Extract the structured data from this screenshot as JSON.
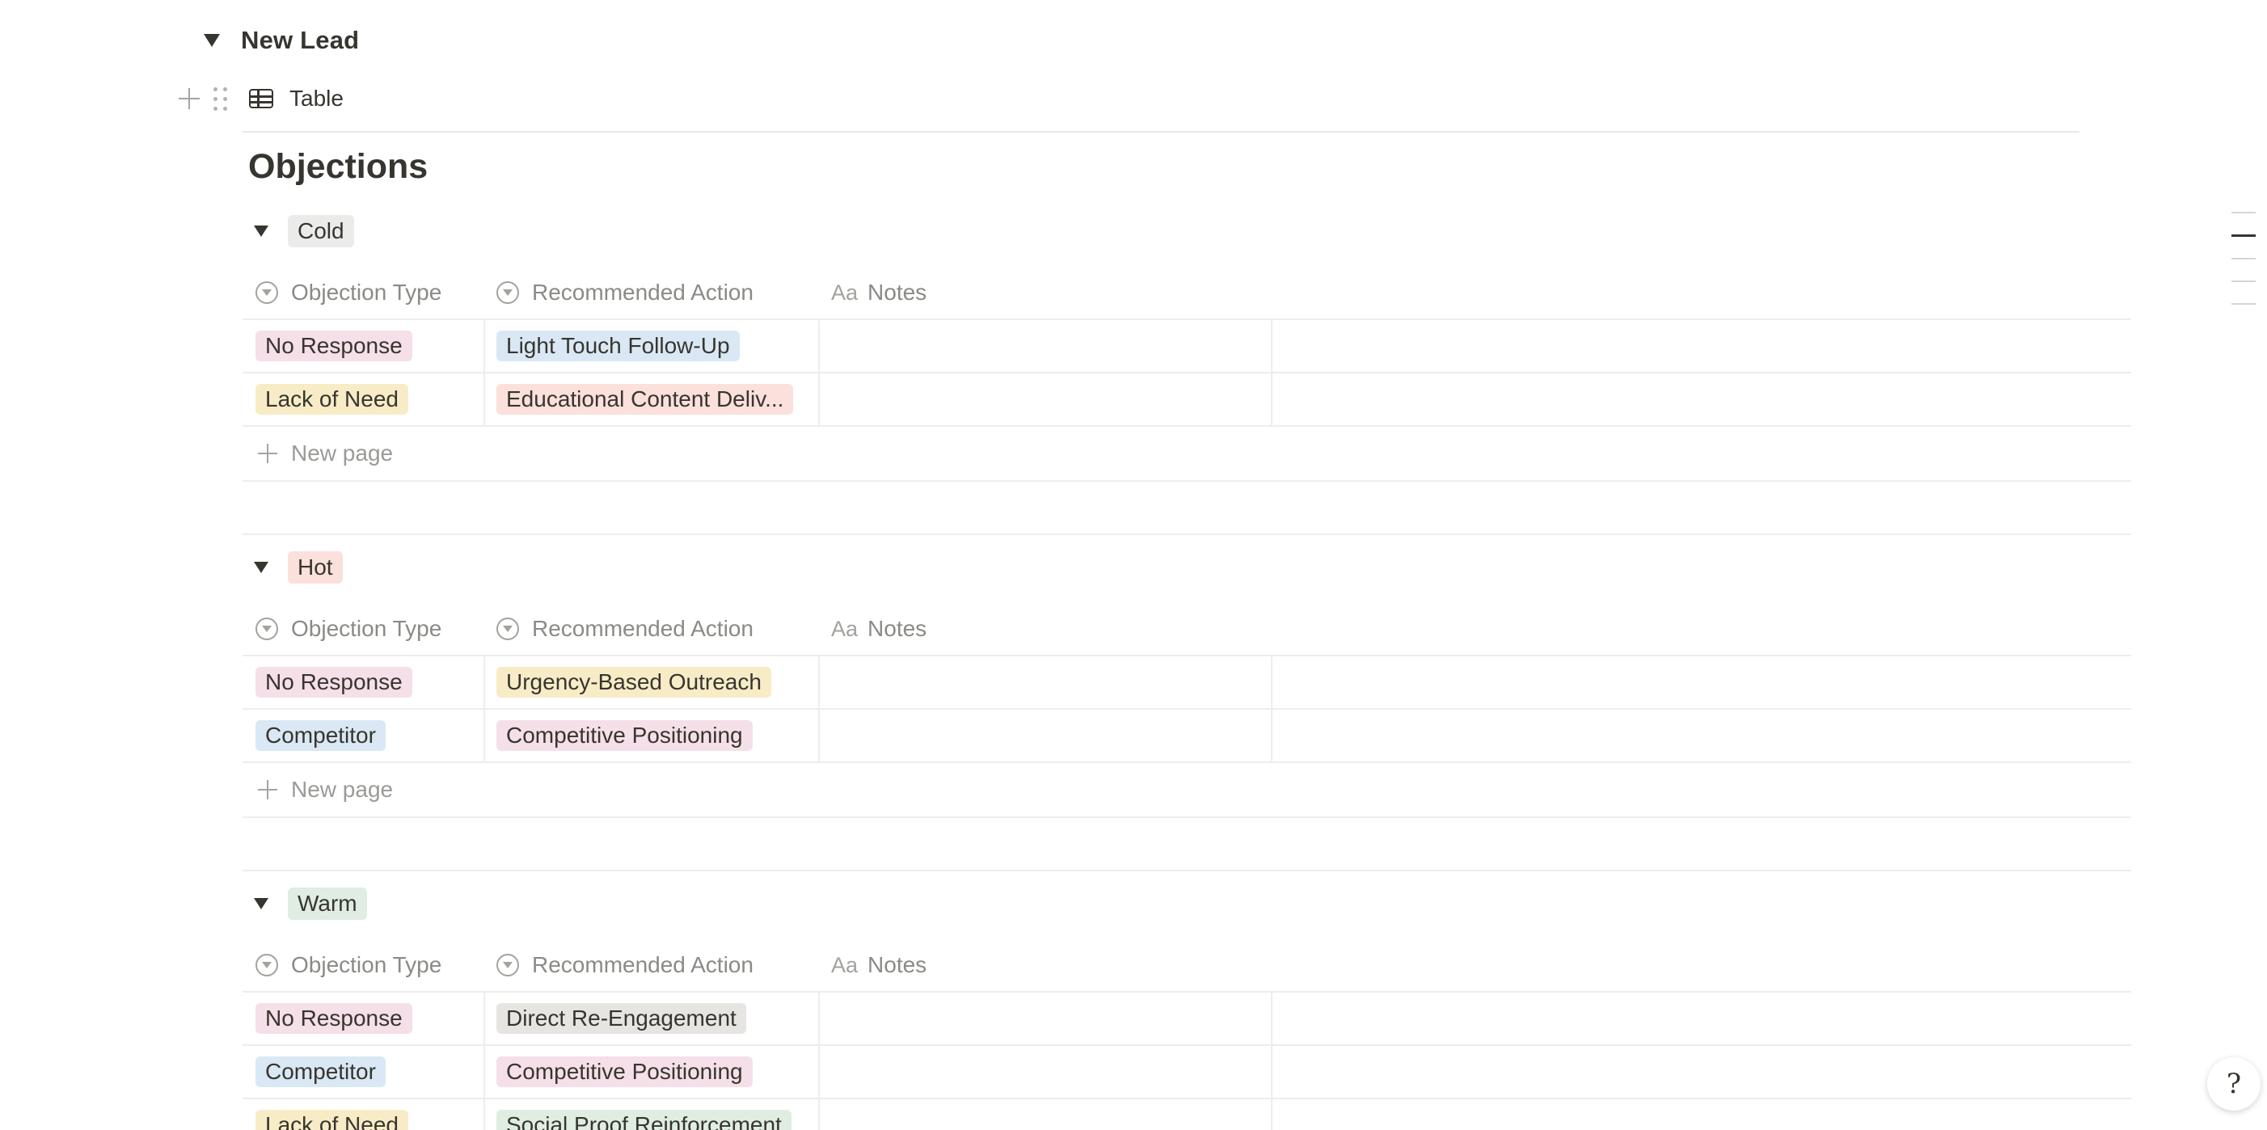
{
  "toggle": {
    "title": "New Lead"
  },
  "view": {
    "label": "Table"
  },
  "page_heading": "Objections",
  "columns": {
    "objection_type": "Objection Type",
    "recommended_action": "Recommended Action",
    "notes": "Notes",
    "notes_icon": "Aa"
  },
  "new_page_label": "New page",
  "colors": {
    "pink": "#f5dfe9",
    "blue": "#d9e8f4",
    "yellow": "#f8ecc7",
    "red": "#fbe0dc",
    "gray": "#e6e5e2",
    "green": "#dfede3",
    "group_gray": "#ebebea"
  },
  "groups": [
    {
      "label": "Cold",
      "color": "gray",
      "rows": [
        {
          "type": "No Response",
          "type_color": "pink",
          "action": "Light Touch Follow-Up",
          "action_color": "blue"
        },
        {
          "type": "Lack of Need",
          "type_color": "yellow",
          "action": "Educational Content Deliv...",
          "action_color": "red"
        }
      ]
    },
    {
      "label": "Hot",
      "color": "red",
      "rows": [
        {
          "type": "No Response",
          "type_color": "pink",
          "action": "Urgency-Based Outreach",
          "action_color": "yellow"
        },
        {
          "type": "Competitor",
          "type_color": "blue",
          "action": "Competitive Positioning",
          "action_color": "pink"
        }
      ]
    },
    {
      "label": "Warm",
      "color": "green",
      "rows": [
        {
          "type": "No Response",
          "type_color": "pink",
          "action": "Direct Re-Engagement",
          "action_color": "gray"
        },
        {
          "type": "Competitor",
          "type_color": "blue",
          "action": "Competitive Positioning",
          "action_color": "pink"
        },
        {
          "type": "Lack of Need",
          "type_color": "yellow",
          "action": "Social Proof Reinforcement",
          "action_color": "green"
        }
      ]
    }
  ],
  "help_glyph": "?"
}
